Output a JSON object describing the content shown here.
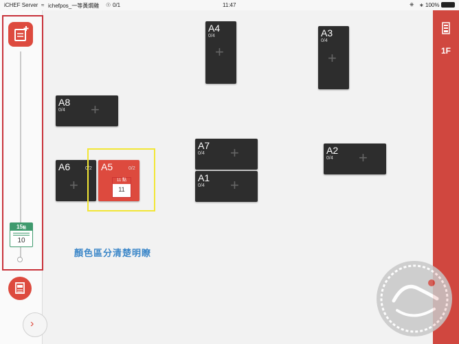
{
  "status": {
    "carrier": "iCHEF Server",
    "wifi_ssid": "ichefpos_一等黃燜雞",
    "sync": "0/1",
    "time": "11:47",
    "battery": "100%"
  },
  "floor_label": "1F",
  "tables": [
    {
      "id": "A4",
      "name": "A4",
      "count": "0/4"
    },
    {
      "id": "A3",
      "name": "A3",
      "count": "0/4"
    },
    {
      "id": "A8",
      "name": "A8",
      "count": "0/4"
    },
    {
      "id": "A7",
      "name": "A7",
      "count": "0/4"
    },
    {
      "id": "A2",
      "name": "A2",
      "count": "0/4"
    },
    {
      "id": "A6",
      "name": "A6",
      "count": "0/2"
    },
    {
      "id": "A5",
      "name": "A5",
      "count": "0/2",
      "order_label": "11 點",
      "order_number": "11"
    },
    {
      "id": "A1",
      "name": "A1",
      "count": "0/4"
    }
  ],
  "sidebar": {
    "timeline_card_top": "15",
    "timeline_card_suffix": "點",
    "timeline_card_bottom": "10"
  },
  "annotation_note": "顏色區分清楚明瞭",
  "colors": {
    "accent": "#dd4a3e",
    "table_bg": "#2d2d2d",
    "note": "#3a86c8",
    "highlight_side": "#c8323a",
    "highlight_table": "#f2e635"
  }
}
